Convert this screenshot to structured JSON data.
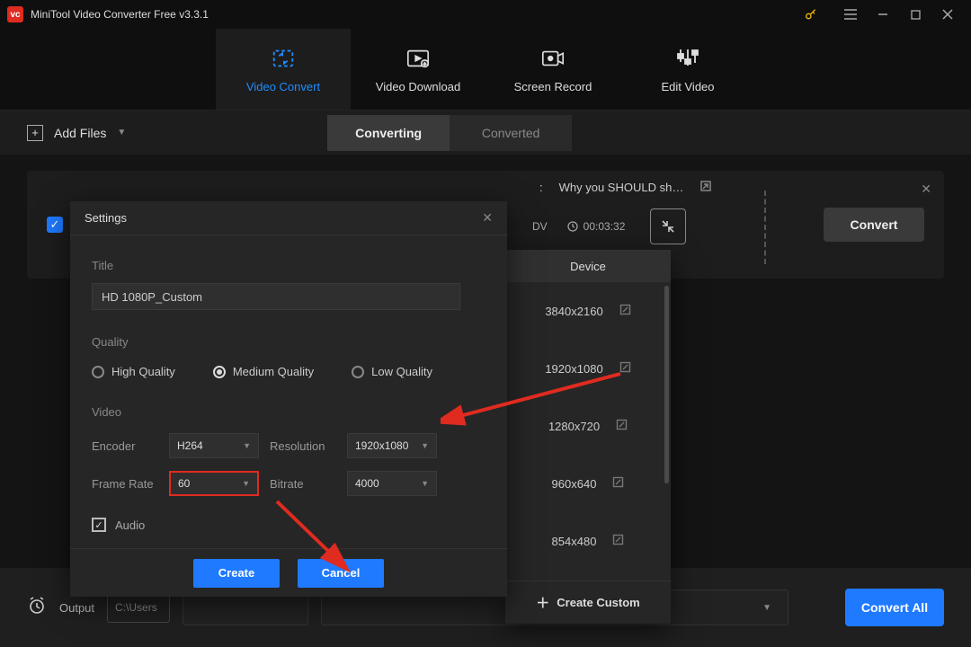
{
  "app": {
    "title": "MiniTool Video Converter Free v3.3.1"
  },
  "nav": {
    "tabs": [
      {
        "label": "Video Convert"
      },
      {
        "label": "Video Download"
      },
      {
        "label": "Screen Record"
      },
      {
        "label": "Edit Video"
      }
    ]
  },
  "toolbar": {
    "add_files": "Add Files",
    "seg_converting": "Converting",
    "seg_converted": "Converted"
  },
  "file": {
    "title_prefix": ":",
    "title": "Why you SHOULD sh…",
    "ext": "DV",
    "duration": "00:03:32",
    "convert": "Convert"
  },
  "dialog": {
    "title": "Settings",
    "title_label": "Title",
    "title_value": "HD 1080P_Custom",
    "quality_label": "Quality",
    "quality_options": [
      "High Quality",
      "Medium Quality",
      "Low Quality"
    ],
    "video_label": "Video",
    "encoder_label": "Encoder",
    "encoder_value": "H264",
    "resolution_label": "Resolution",
    "resolution_value": "1920x1080",
    "framerate_label": "Frame Rate",
    "framerate_value": "60",
    "bitrate_label": "Bitrate",
    "bitrate_value": "4000",
    "audio_label": "Audio",
    "create": "Create",
    "cancel": "Cancel"
  },
  "respanel": {
    "tab": "Device",
    "items": [
      "3840x2160",
      "1920x1080",
      "1280x720",
      "960x640",
      "854x480"
    ],
    "create_custom": "Create Custom"
  },
  "footer": {
    "output_label": "Output",
    "output_path": "C:\\Users",
    "convert_all": "Convert All"
  }
}
